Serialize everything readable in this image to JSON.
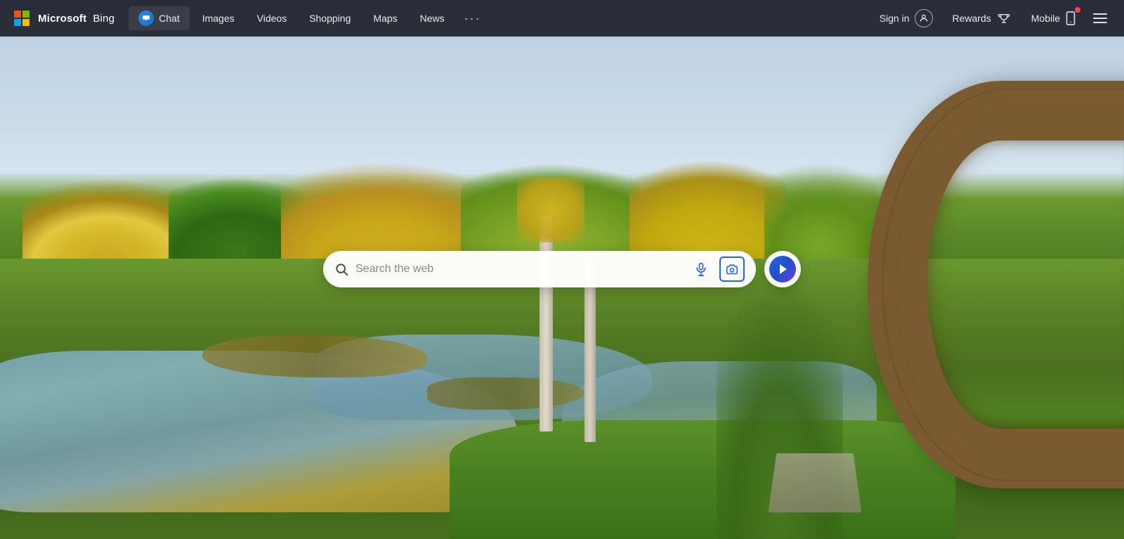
{
  "brand": {
    "company": "Microsoft",
    "product": "Bing"
  },
  "navbar": {
    "chat_label": "Chat",
    "images_label": "Images",
    "videos_label": "Videos",
    "shopping_label": "Shopping",
    "maps_label": "Maps",
    "news_label": "News",
    "more_label": "···",
    "sign_in_label": "Sign in",
    "rewards_label": "Rewards",
    "mobile_label": "Mobile"
  },
  "search": {
    "placeholder": "Search the web",
    "input_value": ""
  },
  "background": {
    "description": "Autumn forest with lake and wooden C-shaped structure"
  },
  "icons": {
    "chat": "chat-bubble-icon",
    "search": "search-icon",
    "mic": "mic-icon",
    "camera": "camera-icon",
    "bing_chat": "bing-chat-icon",
    "person": "person-icon",
    "trophy": "trophy-icon",
    "mobile": "mobile-icon",
    "hamburger": "hamburger-icon"
  }
}
